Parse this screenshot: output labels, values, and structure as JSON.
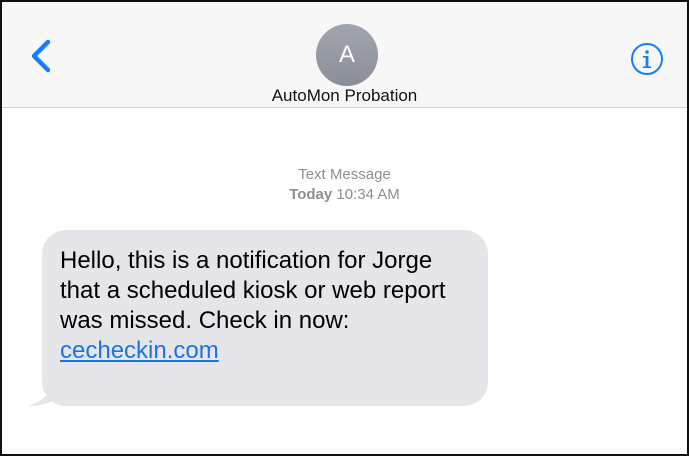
{
  "header": {
    "avatar_initial": "A",
    "contact_name": "AutoMon Probation",
    "back_icon": "chevron-left-icon",
    "info_icon": "info-circle-icon"
  },
  "conversation": {
    "service_label": "Text Message",
    "day_label": "Today",
    "time_label": "10:34 AM",
    "message": {
      "text": "Hello, this is a notification for Jorge that a scheduled kiosk or web report was missed. Check in now: ",
      "link_text": "cecheckin.com"
    }
  },
  "colors": {
    "accent": "#147efb",
    "bubble_incoming": "#e5e5ea",
    "meta_text": "#8e8e93",
    "header_bg": "#f7f7f7"
  }
}
